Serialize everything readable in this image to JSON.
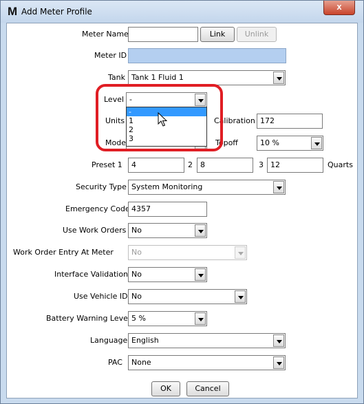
{
  "window": {
    "title": "Add Meter Profile",
    "logo_letter": "M",
    "close_label": "x"
  },
  "form": {
    "meter_name": {
      "label": "Meter Name",
      "value": ""
    },
    "link_button": "Link",
    "unlink_button": "Unlink",
    "meter_id": {
      "label": "Meter ID",
      "value": ""
    },
    "tank": {
      "label": "Tank",
      "value": "Tank 1 Fluid 1"
    },
    "level": {
      "label": "Level",
      "value": "-",
      "options": [
        "-",
        "1",
        "2",
        "3"
      ],
      "selected_index": 0
    },
    "units": {
      "label": "Units"
    },
    "mode": {
      "label": "Mode"
    },
    "calibration": {
      "label": "Calibration",
      "value": "172"
    },
    "topoff": {
      "label": "Topoff",
      "value": "10 %"
    },
    "preset": {
      "label1": "Preset 1",
      "value1": "4",
      "label2": "2",
      "value2": "8",
      "label3": "3",
      "value3": "12",
      "unit": "Quarts"
    },
    "security_type": {
      "label": "Security Type",
      "value": "System Monitoring"
    },
    "emergency_code": {
      "label": "Emergency Code",
      "value": "4357"
    },
    "use_work_orders": {
      "label": "Use Work Orders",
      "value": "No"
    },
    "work_order_entry": {
      "label": "Work Order Entry At Meter",
      "value": "No"
    },
    "interface_validation": {
      "label": "Interface Validation",
      "value": "No"
    },
    "use_vehicle_id": {
      "label": "Use Vehicle ID",
      "value": "No"
    },
    "battery_warning_level": {
      "label": "Battery Warning Level",
      "value": "5 %"
    },
    "language": {
      "label": "Language",
      "value": "English"
    },
    "pac": {
      "label": "PAC",
      "value": "None"
    }
  },
  "buttons": {
    "ok": "OK",
    "cancel": "Cancel"
  },
  "colors": {
    "highlight": "#e01e24",
    "selected_option": "#3399ff",
    "meter_id_fill": "#b4cff0"
  }
}
